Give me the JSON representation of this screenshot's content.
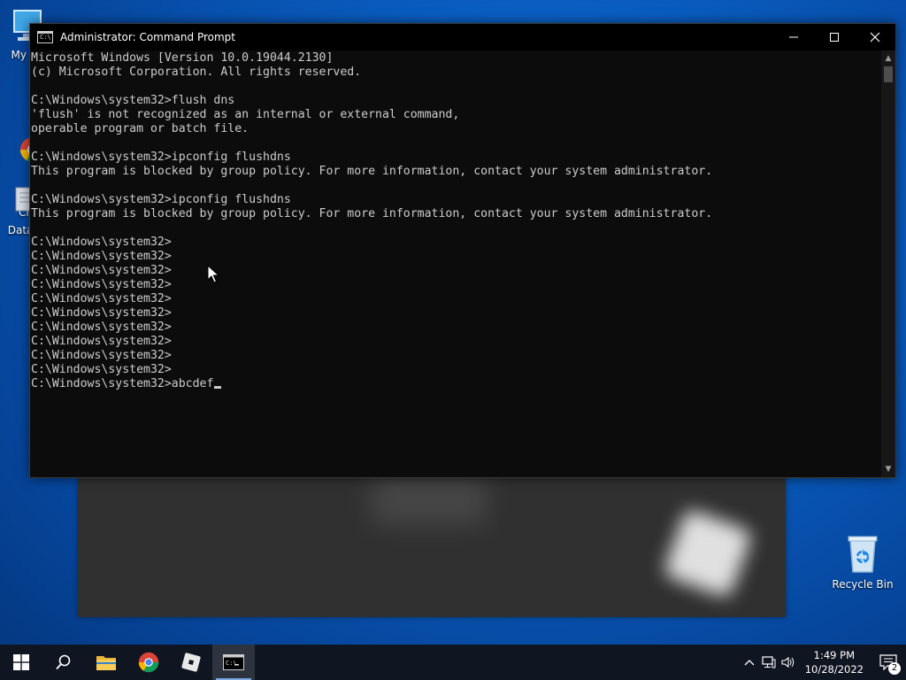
{
  "desktop": {
    "icons": [
      {
        "label": "My Co",
        "icon": "computer-icon"
      },
      {
        "label": "Go\nCh",
        "icon": "chrome-icon"
      },
      {
        "label": "DataW",
        "icon": "datawrapper-icon"
      }
    ],
    "recycle_bin": {
      "label": "Recycle Bin",
      "icon": "recycle-bin-icon"
    }
  },
  "cmd_window": {
    "title": "Administrator: Command Prompt",
    "lines": [
      "Microsoft Windows [Version 10.0.19044.2130]",
      "(c) Microsoft Corporation. All rights reserved.",
      "",
      "C:\\Windows\\system32>flush dns",
      "'flush' is not recognized as an internal or external command,",
      "operable program or batch file.",
      "",
      "C:\\Windows\\system32>ipconfig flushdns",
      "This program is blocked by group policy. For more information, contact your system administrator.",
      "",
      "C:\\Windows\\system32>ipconfig flushdns",
      "This program is blocked by group policy. For more information, contact your system administrator.",
      "",
      "C:\\Windows\\system32>",
      "C:\\Windows\\system32>",
      "C:\\Windows\\system32>",
      "C:\\Windows\\system32>",
      "C:\\Windows\\system32>",
      "C:\\Windows\\system32>",
      "C:\\Windows\\system32>",
      "C:\\Windows\\system32>",
      "C:\\Windows\\system32>",
      "C:\\Windows\\system32>"
    ],
    "current_input": "C:\\Windows\\system32>abcdef"
  },
  "taskbar": {
    "apps": [
      {
        "name": "start",
        "icon": "windows-start-icon"
      },
      {
        "name": "search",
        "icon": "search-icon"
      },
      {
        "name": "file-explorer",
        "icon": "folder-icon"
      },
      {
        "name": "chrome",
        "icon": "chrome-icon"
      },
      {
        "name": "roblox",
        "icon": "roblox-icon"
      },
      {
        "name": "command-prompt",
        "icon": "cmd-icon",
        "active": true
      }
    ],
    "tray": {
      "time": "1:49 PM",
      "date": "10/28/2022",
      "notification_count": "2"
    }
  }
}
